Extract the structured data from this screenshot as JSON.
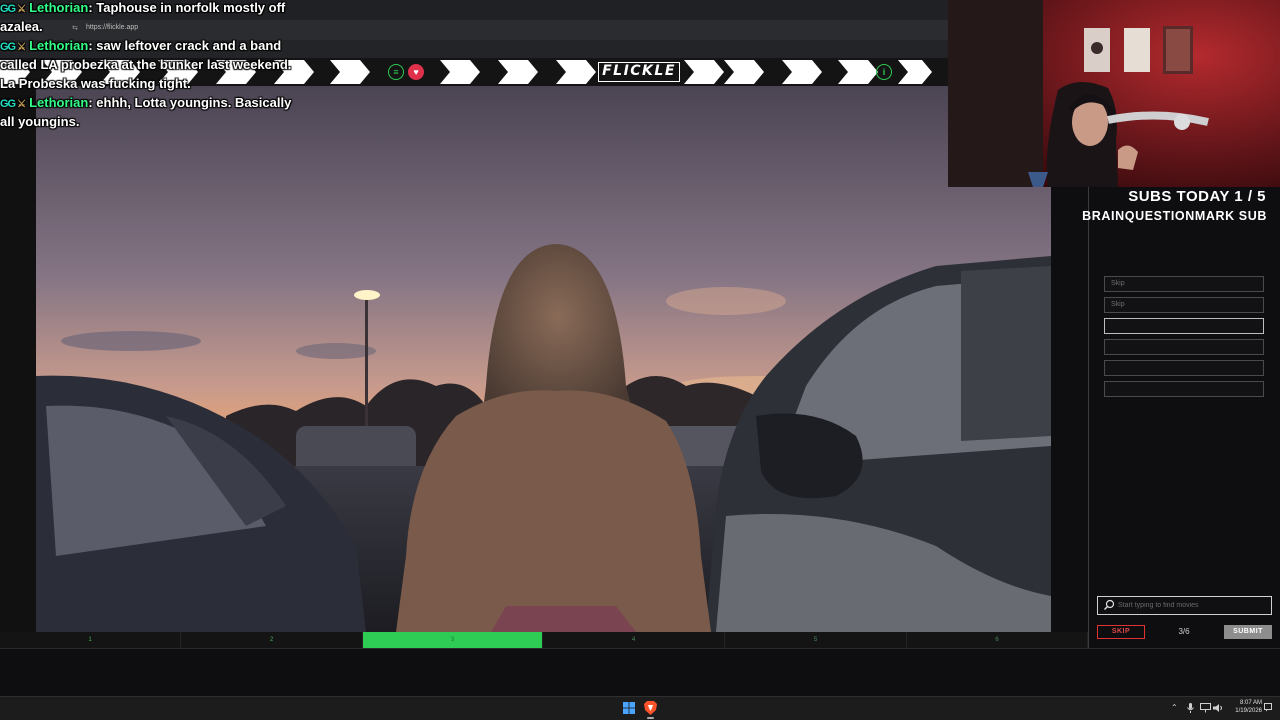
{
  "browser": {
    "url": "https://flickle.app",
    "lock_glyph": "⇆"
  },
  "banner": {
    "logo": "FLICKLE",
    "menu_glyph": "≡",
    "heart_glyph": "♥",
    "info_glyph": "i"
  },
  "chat": [
    {
      "badge": "GG",
      "user": "Lethorian",
      "text": ": Taphouse in norfolk mostly off"
    },
    {
      "text": "azalea."
    },
    {
      "badge": "GG",
      "user": "Lethorian",
      "text": ": saw leftover crack and a band"
    },
    {
      "text": "called LA probezka at the bunker last weekend."
    },
    {
      "text": "La Probeska was fucking tight."
    },
    {
      "badge": "GG",
      "user": "Lethorian",
      "text": ": ehhh, Lotta youngins. Basically"
    },
    {
      "text": "all youngins."
    }
  ],
  "panel": {
    "subs_today": "SUBS TODAY 1 / 5",
    "sub_name": "BRAINQUESTIONMARK SUB",
    "guesses": [
      "Skip",
      "Skip",
      "",
      "",
      "",
      ""
    ],
    "search_placeholder": "Start typing to find movies",
    "skip_label": "SKIP",
    "counter": "3/6",
    "submit_label": "SUBMIT"
  },
  "progress": {
    "segments": [
      "1",
      "2",
      "3",
      "4",
      "5",
      "6"
    ],
    "active_index": 2
  },
  "taskbar": {
    "time": "8:07 AM",
    "date": "1/19/2026"
  },
  "colors": {
    "accent_green": "#2ecc55",
    "heart_red": "#e0314b",
    "skip_red": "#e04848"
  }
}
